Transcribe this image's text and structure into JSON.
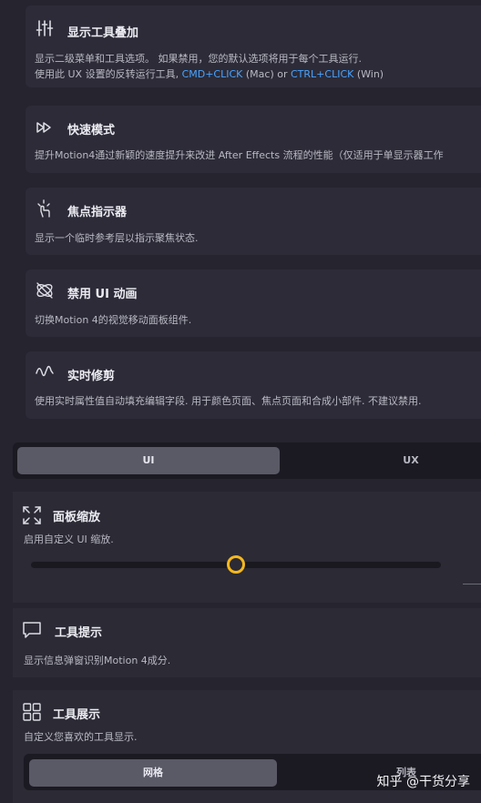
{
  "cards": [
    {
      "title": "显示工具叠加",
      "icon": "sliders-icon",
      "desc1": "显示二级菜单和工具选项。 如果禁用，您的默认选项将用于每个工具运行.",
      "desc2_prefix": "使用此 UX 设置的反转运行工具, ",
      "desc2_cmd": "CMD+CLICK",
      "desc2_mid": " (Mac) or ",
      "desc2_ctrl": "CTRL+CLICK",
      "desc2_suffix": " (Win)"
    },
    {
      "title": "快速模式",
      "icon": "fast-forward-icon",
      "desc1": "提升Motion4通过新颖的速度提升来改进 After Effects 流程的性能（仅适用于单显示器工作"
    },
    {
      "title": "焦点指示器",
      "icon": "pointer-hand-icon",
      "desc1": "显示一个临时参考层以指示聚焦状态."
    },
    {
      "title": "禁用 UI 动画",
      "icon": "orbit-disabled-icon",
      "desc1": "切换Motion 4的视觉移动面板组件."
    },
    {
      "title": "实时修剪",
      "icon": "waveform-icon",
      "desc1": "使用实时属性值自动填充编辑字段. 用于颜色页面、焦点页面和合成小部件. 不建议禁用."
    }
  ],
  "tabs": {
    "ui": "UI",
    "ux": "UX"
  },
  "panel_zoom": {
    "title": "面板缩放",
    "desc": "启用自定义 UI 缩放.",
    "slider_fraction": 0.5
  },
  "tooltips": {
    "title": "工具提示",
    "desc": "显示信息弹窗识别Motion 4成分."
  },
  "tool_display": {
    "title": "工具展示",
    "desc": "自定义您喜欢的工具显示.",
    "grid_label": "网格",
    "list_label": "列表"
  },
  "watermark": "知乎 @干货分享",
  "colors": {
    "accent_blue": "#4aa3ff",
    "slider_knob": "#f5b81c"
  }
}
